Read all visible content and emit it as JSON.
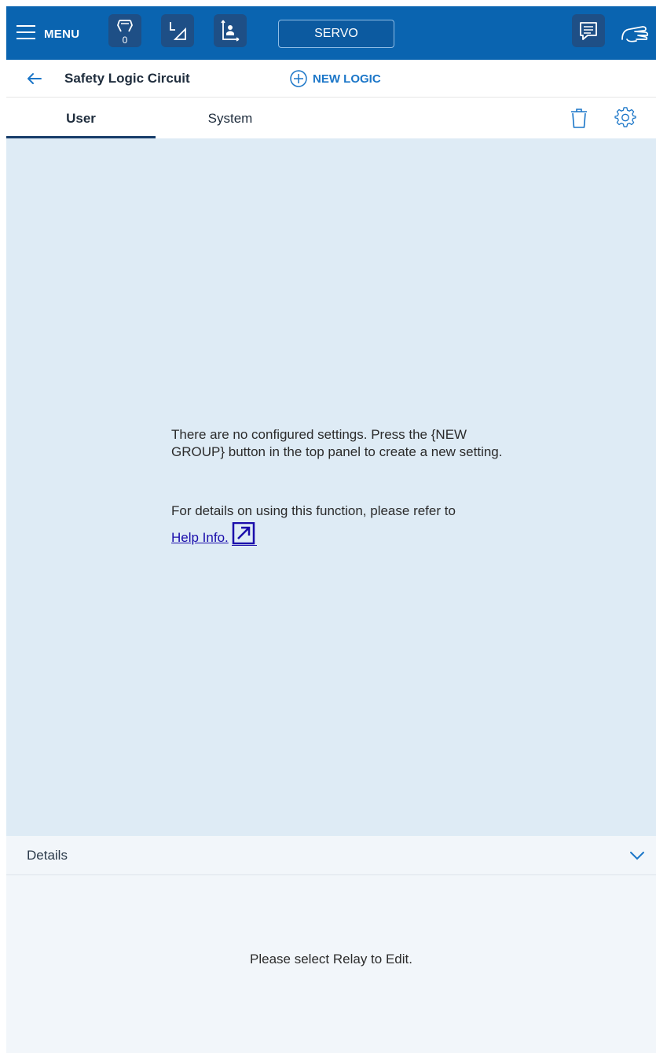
{
  "topbar": {
    "menu_label": "MENU",
    "robot_badge": "0",
    "servo_label": "SERVO"
  },
  "titlebar": {
    "title": "Safety Logic Circuit",
    "new_logic_label": "NEW LOGIC"
  },
  "tabs": [
    {
      "label": "User",
      "active": true
    },
    {
      "label": "System",
      "active": false
    }
  ],
  "main": {
    "empty_message": "There are no configured settings. Press the {NEW GROUP} button in the top panel to create a new setting.",
    "help_prefix": "For details on using this function, please refer to",
    "help_link_text": "Help Info."
  },
  "details": {
    "label": "Details",
    "message": "Please select Relay to Edit."
  },
  "colors": {
    "topbar": "#0a64b0",
    "accent": "#1b76c8",
    "content_bg": "#deebf5",
    "link": "#1a0dab"
  },
  "icons": [
    "hamburger-menu-icon",
    "robot-gripper-icon",
    "coordinate-icon",
    "user-coordinate-icon",
    "message-icon",
    "hand-guide-icon",
    "back-arrow-icon",
    "add-circle-icon",
    "trash-icon",
    "gear-icon",
    "external-link-icon",
    "chevron-down-icon"
  ]
}
